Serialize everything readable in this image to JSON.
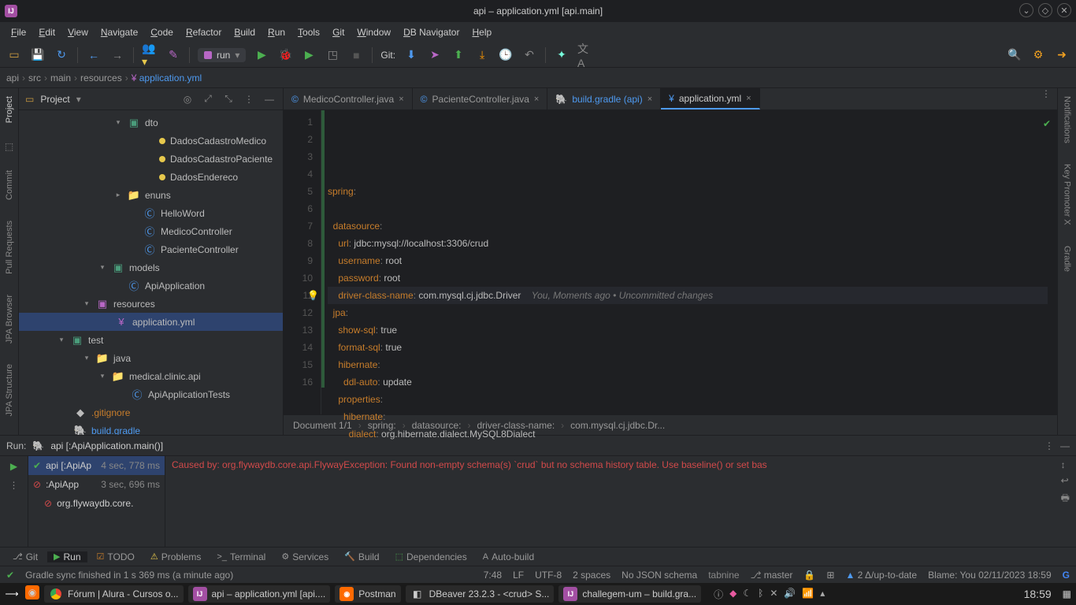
{
  "window": {
    "title": "api – application.yml [api.main]"
  },
  "menu": [
    "File",
    "Edit",
    "View",
    "Navigate",
    "Code",
    "Refactor",
    "Build",
    "Run",
    "Tools",
    "Git",
    "Window",
    "DB Navigator",
    "Help"
  ],
  "toolbar": {
    "git_label": "Git:",
    "run_config": "run"
  },
  "breadcrumb": [
    "api",
    "src",
    "main",
    "resources",
    "application.yml"
  ],
  "project": {
    "panel_title": "Project",
    "items": [
      {
        "indent": 120,
        "chev": "▾",
        "ico": "pkg",
        "label": "dto"
      },
      {
        "indent": 160,
        "ico": "dot",
        "label": "DadosCadastroMedico"
      },
      {
        "indent": 160,
        "ico": "dot",
        "label": "DadosCadastroPaciente"
      },
      {
        "indent": 160,
        "ico": "dot",
        "label": "DadosEndereco"
      },
      {
        "indent": 120,
        "chev": "▸",
        "ico": "folder",
        "label": "enuns"
      },
      {
        "indent": 140,
        "ico": "cls",
        "label": "HelloWord"
      },
      {
        "indent": 140,
        "ico": "cls",
        "label": "MedicoController"
      },
      {
        "indent": 140,
        "ico": "cls",
        "label": "PacienteController"
      },
      {
        "indent": 100,
        "chev": "▾",
        "ico": "pkg",
        "label": "models"
      },
      {
        "indent": 120,
        "ico": "cls",
        "label": "ApiApplication"
      },
      {
        "indent": 80,
        "chev": "▾",
        "ico": "res",
        "label": "resources"
      },
      {
        "indent": 104,
        "ico": "yml",
        "label": "application.yml",
        "selected": true
      },
      {
        "indent": 48,
        "chev": "▾",
        "ico": "pkg",
        "label": "test"
      },
      {
        "indent": 80,
        "chev": "▾",
        "ico": "folder",
        "label": "java"
      },
      {
        "indent": 100,
        "chev": "▾",
        "ico": "folder",
        "label": "medical.clinic.api"
      },
      {
        "indent": 124,
        "ico": "cls",
        "label": "ApiApplicationTests"
      },
      {
        "indent": 52,
        "ico": "git",
        "label": ".gitignore",
        "color": "#c77d2b"
      },
      {
        "indent": 52,
        "ico": "gradle",
        "label": "build.gradle",
        "color": "#4e9af0"
      }
    ]
  },
  "tabs": [
    {
      "label": "MedicoController.java",
      "ico": "©"
    },
    {
      "label": "PacienteController.java",
      "ico": "©"
    },
    {
      "label": "build.gradle (api)",
      "ico": "🐘",
      "color": "#4e9af0"
    },
    {
      "label": "application.yml",
      "ico": "¥",
      "active": true
    }
  ],
  "code": {
    "lines": [
      {
        "n": 1,
        "html": "<span class=ck>spring</span><span class=cp>:</span>"
      },
      {
        "n": 2,
        "html": ""
      },
      {
        "n": 3,
        "html": "  <span class=ck>datasource</span><span class=cp>:</span>"
      },
      {
        "n": 4,
        "html": "    <span class=ck>url</span><span class=cp>:</span> <span class=cv>jdbc:mysql://localhost:3306/crud</span>"
      },
      {
        "n": 5,
        "html": "    <span class=ck>username</span><span class=cp>:</span> <span class=cv>root</span>"
      },
      {
        "n": 6,
        "html": "    <span class=ck>password</span><span class=cp>:</span> <span class=cv>root</span>"
      },
      {
        "n": 7,
        "html": "    <span class=ck>driver-class-name</span><span class=cp>:</span> <span class=cv>com.mysql.cj.jdbc.Driver</span>    <span class=cm>You, Moments ago • Uncommitted changes</span>",
        "hl": true,
        "bulb": true
      },
      {
        "n": 8,
        "html": "  <span class=ck>jpa</span><span class=cp>:</span>"
      },
      {
        "n": 9,
        "html": "    <span class=ck>show-sql</span><span class=cp>:</span> <span class=cv>true</span>"
      },
      {
        "n": 10,
        "html": "    <span class=ck>format-sql</span><span class=cp>:</span> <span class=cv>true</span>"
      },
      {
        "n": 11,
        "html": "    <span class=ck>hibernate</span><span class=cp>:</span>"
      },
      {
        "n": 12,
        "html": "      <span class=ck>ddl-auto</span><span class=cp>:</span> <span class=cv>update</span>"
      },
      {
        "n": 13,
        "html": "    <span class=ck>properties</span><span class=cp>:</span>"
      },
      {
        "n": 14,
        "html": "      <span class=ck>hibernate</span><span class=cp>:</span>"
      },
      {
        "n": 15,
        "html": "        <span class=ck>dialect</span><span class=cp>:</span> <span class=cv>org.hibernate.dialect.MySQL8Dialect</span>"
      },
      {
        "n": 16,
        "html": ""
      }
    ]
  },
  "docbc": {
    "pos": "Document 1/1",
    "path": [
      "spring:",
      "datasource:",
      "driver-class-name:",
      "com.mysql.cj.jdbc.Dr..."
    ]
  },
  "run": {
    "label": "Run:",
    "config": "api [:ApiApplication.main()]",
    "rows": [
      {
        "ico": "✔",
        "name": "api [:ApiAp",
        "time": "4 sec, 778 ms",
        "sel": true,
        "color": "#4caf50"
      },
      {
        "ico": "⊘",
        "name": ":ApiApp",
        "time": "3 sec, 696 ms",
        "color": "#d24a4a"
      },
      {
        "ico": "⊘",
        "name": "org.flywaydb.core.",
        "color": "#d24a4a",
        "indent": 14
      }
    ],
    "error": "Caused by: org.flywaydb.core.api.FlywayException: Found non-empty schema(s) `crud` but no schema history table. Use baseline() or set bas"
  },
  "bottomtabs": [
    {
      "ico": "⎇",
      "label": "Git"
    },
    {
      "ico": "▶",
      "label": "Run",
      "active": true,
      "icoColor": "#4caf50"
    },
    {
      "ico": "☑",
      "label": "TODO",
      "icoColor": "#c77d2b"
    },
    {
      "ico": "⚠",
      "label": "Problems",
      "icoColor": "#e6c84c"
    },
    {
      "ico": ">_",
      "label": "Terminal"
    },
    {
      "ico": "⚙",
      "label": "Services"
    },
    {
      "ico": "🔨",
      "label": "Build"
    },
    {
      "ico": "⬚",
      "label": "Dependencies",
      "icoColor": "#4caf50"
    },
    {
      "ico": "A",
      "label": "Auto-build"
    }
  ],
  "status": {
    "msg": "Gradle sync finished in 1 s 369 ms (a minute ago)",
    "pos": "7:48",
    "le": "LF",
    "enc": "UTF-8",
    "indent": "2 spaces",
    "schema": "No JSON schema",
    "tabnine": "tabnine",
    "branch": "master",
    "delta": "2 Δ/up-to-date",
    "blame": "Blame: You 02/11/2023 18:59"
  },
  "taskbar": {
    "items": [
      {
        "ico": "◉",
        "bg": "#ff6a00"
      },
      {
        "ico": "◯",
        "label": "Fórum | Alura - Cursos o...",
        "chrome": true
      },
      {
        "ico": "IJ",
        "label": "api – application.yml [api....",
        "bg": "#a34fa3"
      },
      {
        "ico": "◉",
        "label": "Postman",
        "bg": "#ff6a00"
      },
      {
        "ico": "◧",
        "label": "DBeaver 23.2.3 - <crud> S..."
      },
      {
        "ico": "IJ",
        "label": "challegem-um – build.gra...",
        "bg": "#a34fa3"
      }
    ],
    "clock": "18:59"
  },
  "leftgutter": [
    "Project",
    "Commit",
    "Pull Requests",
    "JPA Browser",
    "JPA Structure"
  ],
  "rightgutter": [
    "Notifications",
    "Key Promoter X",
    "Gradle"
  ]
}
